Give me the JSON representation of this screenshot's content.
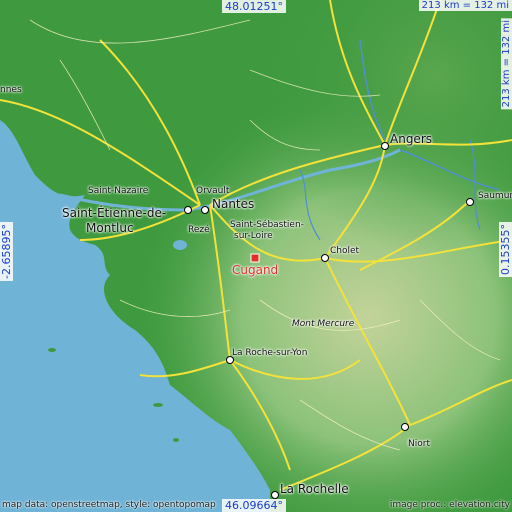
{
  "colors": {
    "sea": "#6fb3d6",
    "land_low": "#3f9a3f",
    "land_mid": "#6fb66a",
    "land_high": "#b8cf8e",
    "road": "#f2e23a",
    "highlight": "#e0302a",
    "coord_text": "#1a3cc8"
  },
  "coords": {
    "top": "48.01251°",
    "bottom": "46.09664°",
    "left": "-2.65895°",
    "right": "0.15355°"
  },
  "scale": {
    "horizontal": "213 km = 132 mi",
    "vertical": "213 km = 132 mi"
  },
  "target": {
    "name": "Cugand"
  },
  "places": {
    "angers": "Angers",
    "nantes": "Nantes",
    "orvault": "Orvault",
    "saint_nazaire": "Saint-Nazaire",
    "saint_etienne_1": "Saint-Étienne-de-",
    "saint_etienne_2": "Montluc",
    "reze": "Rezé",
    "saint_sebastien_1": "Saint-Sébastien-",
    "saint_sebastien_2": "sur-Loire",
    "cholet": "Cholet",
    "saumur": "Saumur",
    "mont_mercure": "Mont Mercure",
    "la_roche": "La Roche-sur-Yon",
    "niort": "Niort",
    "la_rochelle": "La Rochelle",
    "rennes_partial": "nnes"
  },
  "credits": {
    "left": "map data: openstreetmap, style: opentopomap",
    "right": "image proc.: elevation.city"
  }
}
